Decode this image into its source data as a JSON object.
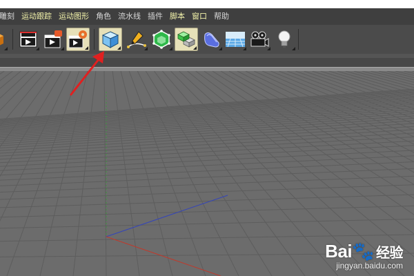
{
  "menu": {
    "items": [
      {
        "label": "雕刻",
        "highlight": false
      },
      {
        "label": "运动跟踪",
        "highlight": true
      },
      {
        "label": "运动图形",
        "highlight": true
      },
      {
        "label": "角色",
        "highlight": false
      },
      {
        "label": "流水线",
        "highlight": false
      },
      {
        "label": "插件",
        "highlight": false
      },
      {
        "label": "脚本",
        "highlight": true
      },
      {
        "label": "窗口",
        "highlight": true
      },
      {
        "label": "帮助",
        "highlight": false
      }
    ]
  },
  "toolbar": {
    "tools": [
      {
        "icon": "cube-partial-icon",
        "active": false
      },
      {
        "icon": "render-view-icon",
        "active": false
      },
      {
        "icon": "render-picture-viewer-icon",
        "active": false
      },
      {
        "icon": "render-settings-icon",
        "active": true
      },
      {
        "icon": "cube-primitive-icon",
        "active": true
      },
      {
        "icon": "pen-spline-icon",
        "active": false
      },
      {
        "icon": "subdivision-surface-icon",
        "active": false
      },
      {
        "icon": "array-clone-icon",
        "active": false
      },
      {
        "icon": "deformer-icon",
        "active": false
      },
      {
        "icon": "floor-plane-icon",
        "active": false
      },
      {
        "icon": "camera-icon",
        "active": false
      },
      {
        "icon": "light-icon",
        "active": false
      }
    ]
  },
  "colors": {
    "menubar_bg": "#3f3f3f",
    "toolbar_bg": "#4b4b4b",
    "viewport_bg": "#6c6c6c",
    "grid_line": "#5d5d5d",
    "axis_x": "#c0392b",
    "axis_y": "#3a9a3a",
    "axis_z": "#3344bb",
    "arrow": "#e02020"
  },
  "watermark": {
    "logo": "Bai",
    "logo_sub": "经验",
    "url": "jingyan.baidu.com"
  }
}
